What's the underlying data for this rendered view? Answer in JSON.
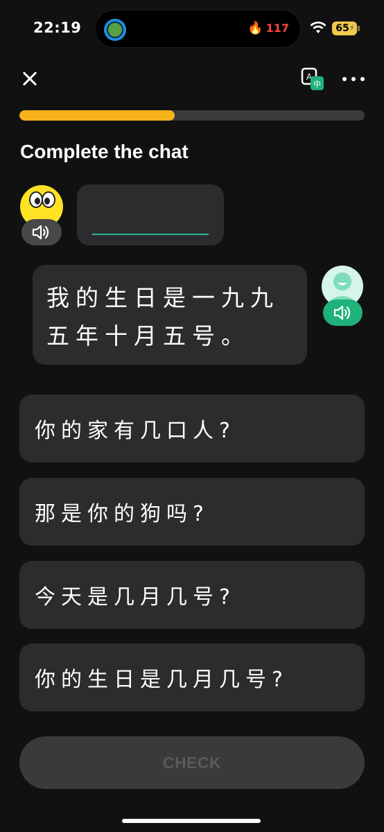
{
  "status_bar": {
    "time": "22:19",
    "streak_count": "117",
    "battery": "65"
  },
  "header": {
    "close_icon": "close-icon",
    "translate_icon": "translate-icon",
    "more_icon": "more-icon"
  },
  "progress": {
    "value": 0.45,
    "color": "#f5b21b"
  },
  "title": "Complete the chat",
  "chat": {
    "left_bubble": {
      "blank": ""
    },
    "right_bubble": {
      "text": "我的生日是一九九五年十月五号。"
    }
  },
  "options": [
    {
      "label": "你的家有几口人?"
    },
    {
      "label": "那是你的狗吗?"
    },
    {
      "label": "今天是几月几号?"
    },
    {
      "label": "你的生日是几月几号?"
    }
  ],
  "check_button": {
    "label": "CHECK"
  },
  "colors": {
    "background": "#111112",
    "card": "#2c2c2e",
    "accent_green": "#1fb27a",
    "progress": "#f5b21b"
  }
}
